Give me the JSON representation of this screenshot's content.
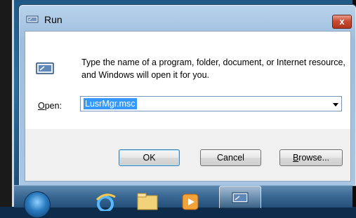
{
  "window": {
    "title": "Run",
    "close_label": "x",
    "message": "Type the name of a program, folder, document, or Internet resource, and Windows will open it for you.",
    "open_label_prefix": "O",
    "open_label_suffix": "pen:",
    "open_value": "LusrMgr.msc",
    "buttons": {
      "ok": "OK",
      "cancel": "Cancel",
      "browse_prefix": "B",
      "browse_suffix": "rowse..."
    }
  },
  "colors": {
    "selection": "#3399ff",
    "close_button": "#c84c33",
    "taskbar": "#3b6a95"
  },
  "icons": [
    "run-icon",
    "close-icon",
    "dropdown-arrow-icon",
    "start-orb-icon",
    "internet-explorer-icon",
    "folder-icon",
    "media-player-icon"
  ]
}
